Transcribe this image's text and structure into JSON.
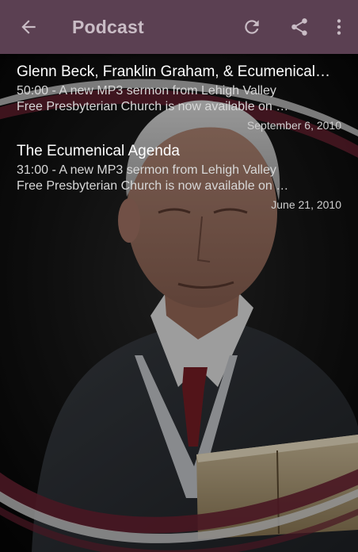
{
  "toolbar": {
    "title": "Podcast",
    "back_icon": "arrow-left-icon",
    "refresh_icon": "refresh-icon",
    "share_icon": "share-icon",
    "overflow_icon": "more-vertical-icon",
    "background_color": "#5b4052",
    "title_color": "#c9bcc5"
  },
  "episodes": [
    {
      "title": "Glenn Beck, Franklin Graham, & Ecumenical…",
      "description_line1": "50:00 - A new MP3 sermon from Lehigh Valley",
      "description_line2": "Free Presbyterian Church is now available on …",
      "date": "September 6, 2010"
    },
    {
      "title": "The Ecumenical Agenda",
      "description_line1": "31:00 - A new MP3 sermon from Lehigh Valley",
      "description_line2": "Free Presbyterian Church is now available on …",
      "date": "June 21, 2010"
    }
  ]
}
